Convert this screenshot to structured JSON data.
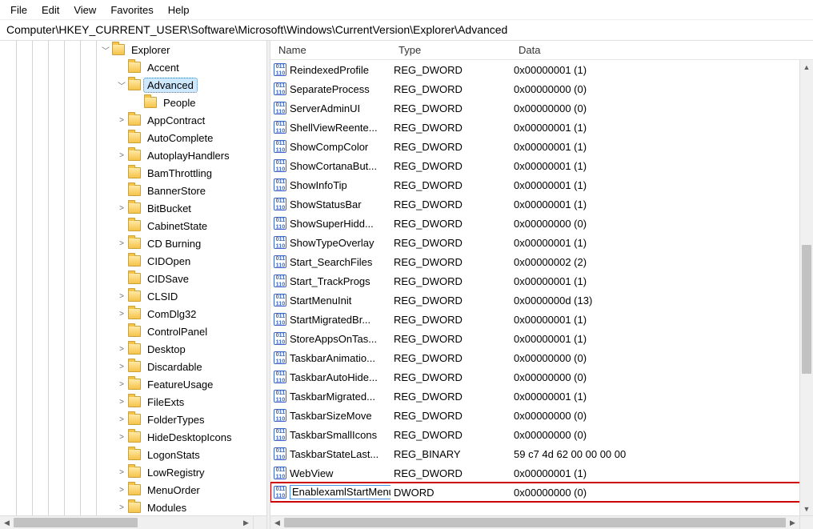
{
  "menu": {
    "items": [
      "File",
      "Edit",
      "View",
      "Favorites",
      "Help"
    ]
  },
  "address": "Computer\\HKEY_CURRENT_USER\\Software\\Microsoft\\Windows\\CurrentVersion\\Explorer\\Advanced",
  "tree": {
    "root": {
      "label": "Explorer",
      "expander": "down",
      "depth": 0
    },
    "items": [
      {
        "label": "Accent",
        "expander": "",
        "depth": 1
      },
      {
        "label": "Advanced",
        "expander": "down",
        "depth": 1,
        "selected": true
      },
      {
        "label": "People",
        "expander": "",
        "depth": 2
      },
      {
        "label": "AppContract",
        "expander": "right",
        "depth": 1
      },
      {
        "label": "AutoComplete",
        "expander": "",
        "depth": 1
      },
      {
        "label": "AutoplayHandlers",
        "expander": "right",
        "depth": 1
      },
      {
        "label": "BamThrottling",
        "expander": "",
        "depth": 1
      },
      {
        "label": "BannerStore",
        "expander": "",
        "depth": 1
      },
      {
        "label": "BitBucket",
        "expander": "right",
        "depth": 1
      },
      {
        "label": "CabinetState",
        "expander": "",
        "depth": 1
      },
      {
        "label": "CD Burning",
        "expander": "right",
        "depth": 1
      },
      {
        "label": "CIDOpen",
        "expander": "",
        "depth": 1
      },
      {
        "label": "CIDSave",
        "expander": "",
        "depth": 1
      },
      {
        "label": "CLSID",
        "expander": "right",
        "depth": 1
      },
      {
        "label": "ComDlg32",
        "expander": "right",
        "depth": 1
      },
      {
        "label": "ControlPanel",
        "expander": "",
        "depth": 1
      },
      {
        "label": "Desktop",
        "expander": "right",
        "depth": 1
      },
      {
        "label": "Discardable",
        "expander": "right",
        "depth": 1
      },
      {
        "label": "FeatureUsage",
        "expander": "right",
        "depth": 1
      },
      {
        "label": "FileExts",
        "expander": "right",
        "depth": 1
      },
      {
        "label": "FolderTypes",
        "expander": "right",
        "depth": 1
      },
      {
        "label": "HideDesktopIcons",
        "expander": "right",
        "depth": 1
      },
      {
        "label": "LogonStats",
        "expander": "",
        "depth": 1
      },
      {
        "label": "LowRegistry",
        "expander": "right",
        "depth": 1
      },
      {
        "label": "MenuOrder",
        "expander": "right",
        "depth": 1
      },
      {
        "label": "Modules",
        "expander": "right",
        "depth": 1
      }
    ]
  },
  "list": {
    "headers": {
      "name": "Name",
      "type": "Type",
      "data": "Data"
    },
    "rows": [
      {
        "name": "ReindexedProfile",
        "type": "REG_DWORD",
        "data": "0x00000001 (1)"
      },
      {
        "name": "SeparateProcess",
        "type": "REG_DWORD",
        "data": "0x00000000 (0)"
      },
      {
        "name": "ServerAdminUI",
        "type": "REG_DWORD",
        "data": "0x00000000 (0)"
      },
      {
        "name": "ShellViewReente...",
        "type": "REG_DWORD",
        "data": "0x00000001 (1)"
      },
      {
        "name": "ShowCompColor",
        "type": "REG_DWORD",
        "data": "0x00000001 (1)"
      },
      {
        "name": "ShowCortanaBut...",
        "type": "REG_DWORD",
        "data": "0x00000001 (1)"
      },
      {
        "name": "ShowInfoTip",
        "type": "REG_DWORD",
        "data": "0x00000001 (1)"
      },
      {
        "name": "ShowStatusBar",
        "type": "REG_DWORD",
        "data": "0x00000001 (1)"
      },
      {
        "name": "ShowSuperHidd...",
        "type": "REG_DWORD",
        "data": "0x00000000 (0)"
      },
      {
        "name": "ShowTypeOverlay",
        "type": "REG_DWORD",
        "data": "0x00000001 (1)"
      },
      {
        "name": "Start_SearchFiles",
        "type": "REG_DWORD",
        "data": "0x00000002 (2)"
      },
      {
        "name": "Start_TrackProgs",
        "type": "REG_DWORD",
        "data": "0x00000001 (1)"
      },
      {
        "name": "StartMenuInit",
        "type": "REG_DWORD",
        "data": "0x0000000d (13)"
      },
      {
        "name": "StartMigratedBr...",
        "type": "REG_DWORD",
        "data": "0x00000001 (1)"
      },
      {
        "name": "StoreAppsOnTas...",
        "type": "REG_DWORD",
        "data": "0x00000001 (1)"
      },
      {
        "name": "TaskbarAnimatio...",
        "type": "REG_DWORD",
        "data": "0x00000000 (0)"
      },
      {
        "name": "TaskbarAutoHide...",
        "type": "REG_DWORD",
        "data": "0x00000000 (0)"
      },
      {
        "name": "TaskbarMigrated...",
        "type": "REG_DWORD",
        "data": "0x00000001 (1)"
      },
      {
        "name": "TaskbarSizeMove",
        "type": "REG_DWORD",
        "data": "0x00000000 (0)"
      },
      {
        "name": "TaskbarSmallIcons",
        "type": "REG_DWORD",
        "data": "0x00000000 (0)"
      },
      {
        "name": "TaskbarStateLast...",
        "type": "REG_BINARY",
        "data": "59 c7 4d 62 00 00 00 00"
      },
      {
        "name": "WebView",
        "type": "REG_DWORD",
        "data": "0x00000001 (1)"
      },
      {
        "name": "EnablexamlStartMenu",
        "type": "DWORD",
        "data": "0x00000000 (0)",
        "editing": true,
        "highlight": true
      }
    ]
  }
}
